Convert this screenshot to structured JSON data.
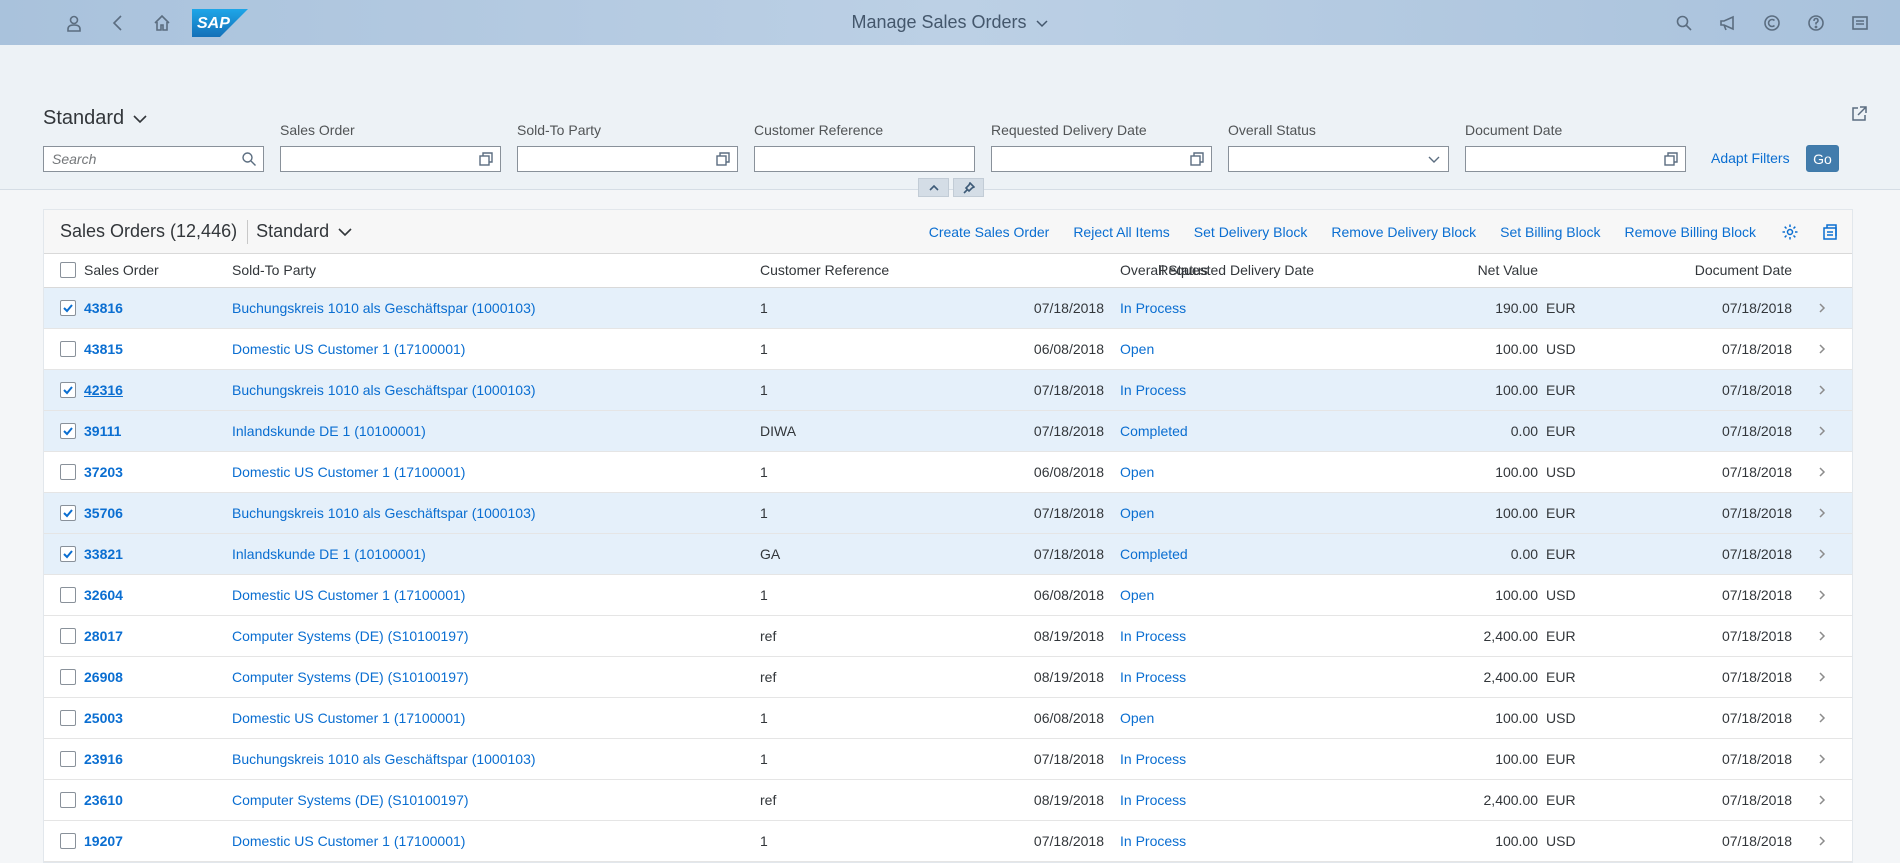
{
  "shell": {
    "title": "Manage Sales Orders",
    "logo_text": "SAP"
  },
  "header": {
    "variant": "Standard",
    "filters": {
      "search_placeholder": "Search",
      "sales_order_label": "Sales Order",
      "sold_to_party_label": "Sold-To Party",
      "customer_reference_label": "Customer Reference",
      "requested_delivery_date_label": "Requested Delivery Date",
      "overall_status_label": "Overall Status",
      "document_date_label": "Document Date"
    },
    "adapt_filters": "Adapt Filters",
    "go": "Go"
  },
  "table": {
    "title": "Sales Orders (12,446)",
    "variant": "Standard",
    "actions": {
      "create": "Create Sales Order",
      "reject": "Reject All Items",
      "set_delivery_block": "Set Delivery Block",
      "remove_delivery_block": "Remove Delivery Block",
      "set_billing_block": "Set Billing Block",
      "remove_billing_block": "Remove Billing Block"
    },
    "columns": {
      "sales_order": "Sales Order",
      "sold_to_party": "Sold-To Party",
      "customer_reference": "Customer Reference",
      "requested_delivery_date": "Requested Delivery Date",
      "overall_status": "Overall Status",
      "net_value": "Net Value",
      "document_date": "Document Date"
    },
    "rows": [
      {
        "selected": true,
        "so": "43816",
        "party": "Buchungskreis 1010 als Geschäftspar (1000103)",
        "ref": "1",
        "rdd": "07/18/2018",
        "status": "In Process",
        "value": "190.00",
        "cur": "EUR",
        "docdate": "07/18/2018"
      },
      {
        "selected": false,
        "so": "43815",
        "party": "Domestic US Customer 1 (17100001)",
        "ref": "1",
        "rdd": "06/08/2018",
        "status": "Open",
        "value": "100.00",
        "cur": "USD",
        "docdate": "07/18/2018"
      },
      {
        "selected": true,
        "so": "42316",
        "party": "Buchungskreis 1010 als Geschäftspar (1000103)",
        "ref": "1",
        "rdd": "07/18/2018",
        "status": "In Process",
        "value": "100.00",
        "cur": "EUR",
        "docdate": "07/18/2018"
      },
      {
        "selected": true,
        "so": "39111",
        "party": "Inlandskunde DE 1 (10100001)",
        "ref": "DIWA",
        "rdd": "07/18/2018",
        "status": "Completed",
        "value": "0.00",
        "cur": "EUR",
        "docdate": "07/18/2018"
      },
      {
        "selected": false,
        "so": "37203",
        "party": "Domestic US Customer 1 (17100001)",
        "ref": "1",
        "rdd": "06/08/2018",
        "status": "Open",
        "value": "100.00",
        "cur": "USD",
        "docdate": "07/18/2018"
      },
      {
        "selected": true,
        "so": "35706",
        "party": "Buchungskreis 1010 als Geschäftspar (1000103)",
        "ref": "1",
        "rdd": "07/18/2018",
        "status": "Open",
        "value": "100.00",
        "cur": "EUR",
        "docdate": "07/18/2018"
      },
      {
        "selected": true,
        "so": "33821",
        "party": "Inlandskunde DE 1 (10100001)",
        "ref": "GA",
        "rdd": "07/18/2018",
        "status": "Completed",
        "value": "0.00",
        "cur": "EUR",
        "docdate": "07/18/2018"
      },
      {
        "selected": false,
        "so": "32604",
        "party": "Domestic US Customer 1 (17100001)",
        "ref": "1",
        "rdd": "06/08/2018",
        "status": "Open",
        "value": "100.00",
        "cur": "USD",
        "docdate": "07/18/2018"
      },
      {
        "selected": false,
        "so": "28017",
        "party": "Computer Systems (DE) (S10100197)",
        "ref": "ref",
        "rdd": "08/19/2018",
        "status": "In Process",
        "value": "2,400.00",
        "cur": "EUR",
        "docdate": "07/18/2018"
      },
      {
        "selected": false,
        "so": "26908",
        "party": "Computer Systems (DE) (S10100197)",
        "ref": "ref",
        "rdd": "08/19/2018",
        "status": "In Process",
        "value": "2,400.00",
        "cur": "EUR",
        "docdate": "07/18/2018"
      },
      {
        "selected": false,
        "so": "25003",
        "party": "Domestic US Customer 1 (17100001)",
        "ref": "1",
        "rdd": "06/08/2018",
        "status": "Open",
        "value": "100.00",
        "cur": "USD",
        "docdate": "07/18/2018"
      },
      {
        "selected": false,
        "so": "23916",
        "party": "Buchungskreis 1010 als Geschäftspar (1000103)",
        "ref": "1",
        "rdd": "07/18/2018",
        "status": "In Process",
        "value": "100.00",
        "cur": "EUR",
        "docdate": "07/18/2018"
      },
      {
        "selected": false,
        "so": "23610",
        "party": "Computer Systems (DE) (S10100197)",
        "ref": "ref",
        "rdd": "08/19/2018",
        "status": "In Process",
        "value": "2,400.00",
        "cur": "EUR",
        "docdate": "07/18/2018"
      },
      {
        "selected": false,
        "so": "19207",
        "party": "Domestic US Customer 1 (17100001)",
        "ref": "1",
        "rdd": "07/18/2018",
        "status": "In Process",
        "value": "100.00",
        "cur": "USD",
        "docdate": "07/18/2018"
      }
    ]
  },
  "colors": {
    "link": "#0a6ed1",
    "selected_row": "#e5f0fa",
    "shell": "#b0c8e0",
    "go_button": "#427cac"
  }
}
